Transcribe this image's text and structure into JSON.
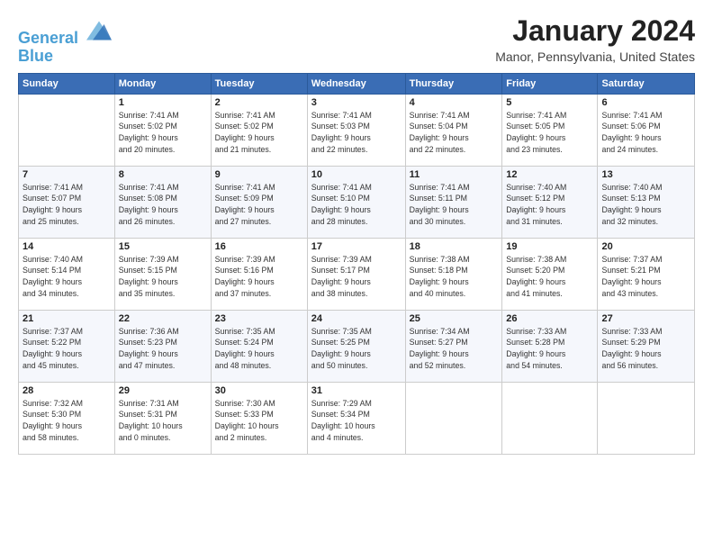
{
  "header": {
    "logo_line1": "General",
    "logo_line2": "Blue",
    "month": "January 2024",
    "location": "Manor, Pennsylvania, United States"
  },
  "weekdays": [
    "Sunday",
    "Monday",
    "Tuesday",
    "Wednesday",
    "Thursday",
    "Friday",
    "Saturday"
  ],
  "weeks": [
    [
      {
        "day": "",
        "info": ""
      },
      {
        "day": "1",
        "info": "Sunrise: 7:41 AM\nSunset: 5:02 PM\nDaylight: 9 hours\nand 20 minutes."
      },
      {
        "day": "2",
        "info": "Sunrise: 7:41 AM\nSunset: 5:02 PM\nDaylight: 9 hours\nand 21 minutes."
      },
      {
        "day": "3",
        "info": "Sunrise: 7:41 AM\nSunset: 5:03 PM\nDaylight: 9 hours\nand 22 minutes."
      },
      {
        "day": "4",
        "info": "Sunrise: 7:41 AM\nSunset: 5:04 PM\nDaylight: 9 hours\nand 22 minutes."
      },
      {
        "day": "5",
        "info": "Sunrise: 7:41 AM\nSunset: 5:05 PM\nDaylight: 9 hours\nand 23 minutes."
      },
      {
        "day": "6",
        "info": "Sunrise: 7:41 AM\nSunset: 5:06 PM\nDaylight: 9 hours\nand 24 minutes."
      }
    ],
    [
      {
        "day": "7",
        "info": "Sunrise: 7:41 AM\nSunset: 5:07 PM\nDaylight: 9 hours\nand 25 minutes."
      },
      {
        "day": "8",
        "info": "Sunrise: 7:41 AM\nSunset: 5:08 PM\nDaylight: 9 hours\nand 26 minutes."
      },
      {
        "day": "9",
        "info": "Sunrise: 7:41 AM\nSunset: 5:09 PM\nDaylight: 9 hours\nand 27 minutes."
      },
      {
        "day": "10",
        "info": "Sunrise: 7:41 AM\nSunset: 5:10 PM\nDaylight: 9 hours\nand 28 minutes."
      },
      {
        "day": "11",
        "info": "Sunrise: 7:41 AM\nSunset: 5:11 PM\nDaylight: 9 hours\nand 30 minutes."
      },
      {
        "day": "12",
        "info": "Sunrise: 7:40 AM\nSunset: 5:12 PM\nDaylight: 9 hours\nand 31 minutes."
      },
      {
        "day": "13",
        "info": "Sunrise: 7:40 AM\nSunset: 5:13 PM\nDaylight: 9 hours\nand 32 minutes."
      }
    ],
    [
      {
        "day": "14",
        "info": "Sunrise: 7:40 AM\nSunset: 5:14 PM\nDaylight: 9 hours\nand 34 minutes."
      },
      {
        "day": "15",
        "info": "Sunrise: 7:39 AM\nSunset: 5:15 PM\nDaylight: 9 hours\nand 35 minutes."
      },
      {
        "day": "16",
        "info": "Sunrise: 7:39 AM\nSunset: 5:16 PM\nDaylight: 9 hours\nand 37 minutes."
      },
      {
        "day": "17",
        "info": "Sunrise: 7:39 AM\nSunset: 5:17 PM\nDaylight: 9 hours\nand 38 minutes."
      },
      {
        "day": "18",
        "info": "Sunrise: 7:38 AM\nSunset: 5:18 PM\nDaylight: 9 hours\nand 40 minutes."
      },
      {
        "day": "19",
        "info": "Sunrise: 7:38 AM\nSunset: 5:20 PM\nDaylight: 9 hours\nand 41 minutes."
      },
      {
        "day": "20",
        "info": "Sunrise: 7:37 AM\nSunset: 5:21 PM\nDaylight: 9 hours\nand 43 minutes."
      }
    ],
    [
      {
        "day": "21",
        "info": "Sunrise: 7:37 AM\nSunset: 5:22 PM\nDaylight: 9 hours\nand 45 minutes."
      },
      {
        "day": "22",
        "info": "Sunrise: 7:36 AM\nSunset: 5:23 PM\nDaylight: 9 hours\nand 47 minutes."
      },
      {
        "day": "23",
        "info": "Sunrise: 7:35 AM\nSunset: 5:24 PM\nDaylight: 9 hours\nand 48 minutes."
      },
      {
        "day": "24",
        "info": "Sunrise: 7:35 AM\nSunset: 5:25 PM\nDaylight: 9 hours\nand 50 minutes."
      },
      {
        "day": "25",
        "info": "Sunrise: 7:34 AM\nSunset: 5:27 PM\nDaylight: 9 hours\nand 52 minutes."
      },
      {
        "day": "26",
        "info": "Sunrise: 7:33 AM\nSunset: 5:28 PM\nDaylight: 9 hours\nand 54 minutes."
      },
      {
        "day": "27",
        "info": "Sunrise: 7:33 AM\nSunset: 5:29 PM\nDaylight: 9 hours\nand 56 minutes."
      }
    ],
    [
      {
        "day": "28",
        "info": "Sunrise: 7:32 AM\nSunset: 5:30 PM\nDaylight: 9 hours\nand 58 minutes."
      },
      {
        "day": "29",
        "info": "Sunrise: 7:31 AM\nSunset: 5:31 PM\nDaylight: 10 hours\nand 0 minutes."
      },
      {
        "day": "30",
        "info": "Sunrise: 7:30 AM\nSunset: 5:33 PM\nDaylight: 10 hours\nand 2 minutes."
      },
      {
        "day": "31",
        "info": "Sunrise: 7:29 AM\nSunset: 5:34 PM\nDaylight: 10 hours\nand 4 minutes."
      },
      {
        "day": "",
        "info": ""
      },
      {
        "day": "",
        "info": ""
      },
      {
        "day": "",
        "info": ""
      }
    ]
  ]
}
